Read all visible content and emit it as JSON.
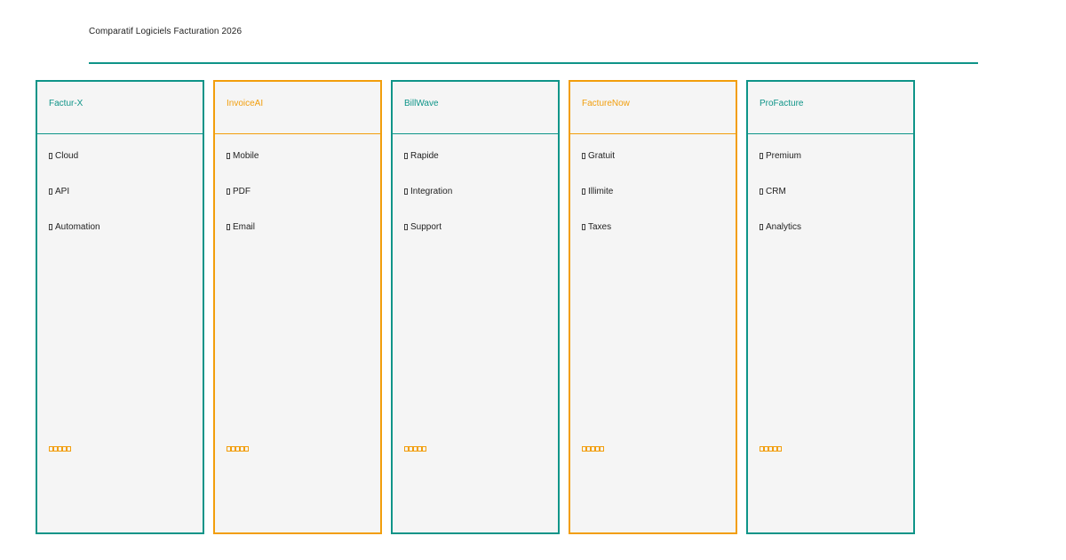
{
  "page": {
    "title": "Comparatif Logiciels Facturation 2026"
  },
  "colors": {
    "primary": "#0e9488",
    "accent": "#f29e0c",
    "card_background": "#f5f5f5"
  },
  "cards": [
    {
      "name": "Factur-X",
      "style": "primary",
      "features": [
        "Cloud",
        "API",
        "Automation"
      ],
      "feature_icon": "check-icon",
      "rating": 5,
      "rating_icon": "star-icon"
    },
    {
      "name": "InvoiceAI",
      "style": "accent",
      "features": [
        "Mobile",
        "PDF",
        "Email"
      ],
      "feature_icon": "check-icon",
      "rating": 5,
      "rating_icon": "star-icon"
    },
    {
      "name": "BillWave",
      "style": "primary",
      "features": [
        "Rapide",
        "Integration",
        "Support"
      ],
      "feature_icon": "check-icon",
      "rating": 5,
      "rating_icon": "star-icon"
    },
    {
      "name": "FactureNow",
      "style": "accent",
      "features": [
        "Gratuit",
        "Illimite",
        "Taxes"
      ],
      "feature_icon": "check-icon",
      "rating": 5,
      "rating_icon": "star-icon"
    },
    {
      "name": "ProFacture",
      "style": "primary",
      "features": [
        "Premium",
        "CRM",
        "Analytics"
      ],
      "feature_icon": "check-icon",
      "rating": 5,
      "rating_icon": "star-icon"
    }
  ]
}
